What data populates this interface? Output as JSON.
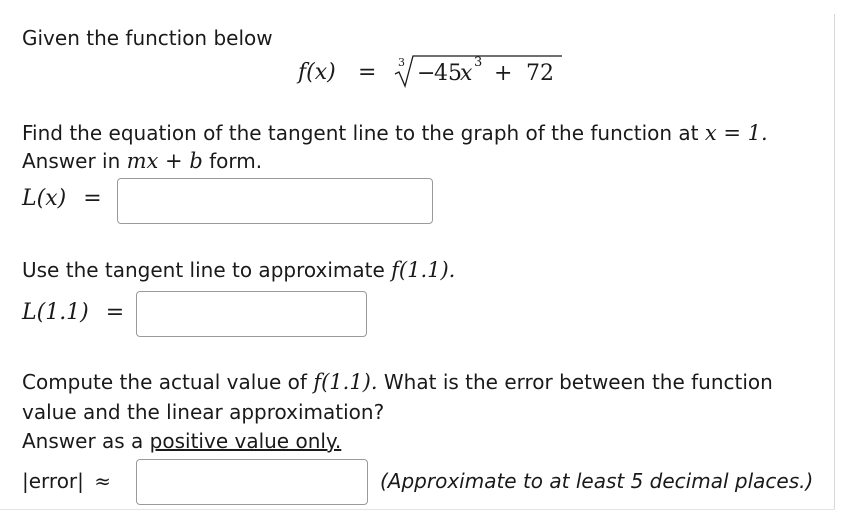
{
  "intro": "Given the function below",
  "function": {
    "lhs": "f(x)",
    "eq": "=",
    "index": "3",
    "minus": "−",
    "coef": "45",
    "var": "x",
    "exp": "3",
    "plus": "+",
    "const": "72"
  },
  "part1": {
    "prompt_text": "Find the equation of the tangent line to the graph of the function at",
    "point": "x = 1.",
    "answer_text": "Answer in",
    "answer_form": "mx + b",
    "answer_suffix": "form.",
    "label": "L(x)",
    "eq": "=",
    "input_value": ""
  },
  "part2": {
    "prompt_text": "Use the tangent line to approximate",
    "expr": "f(1.1).",
    "label": "L(1.1)",
    "eq": "=",
    "input_value": ""
  },
  "part3": {
    "line1_text": "Compute the actual value of",
    "expr": "f(1.1).",
    "line1_suffix": "What is the error between the function",
    "line2": "value and the linear approximation?",
    "line3_prefix": "Answer as a",
    "line3_underlined": "positive value only.",
    "label": "|error|",
    "approx": "≈",
    "input_value": "",
    "note": "(Approximate to at least 5 decimal places.)"
  }
}
